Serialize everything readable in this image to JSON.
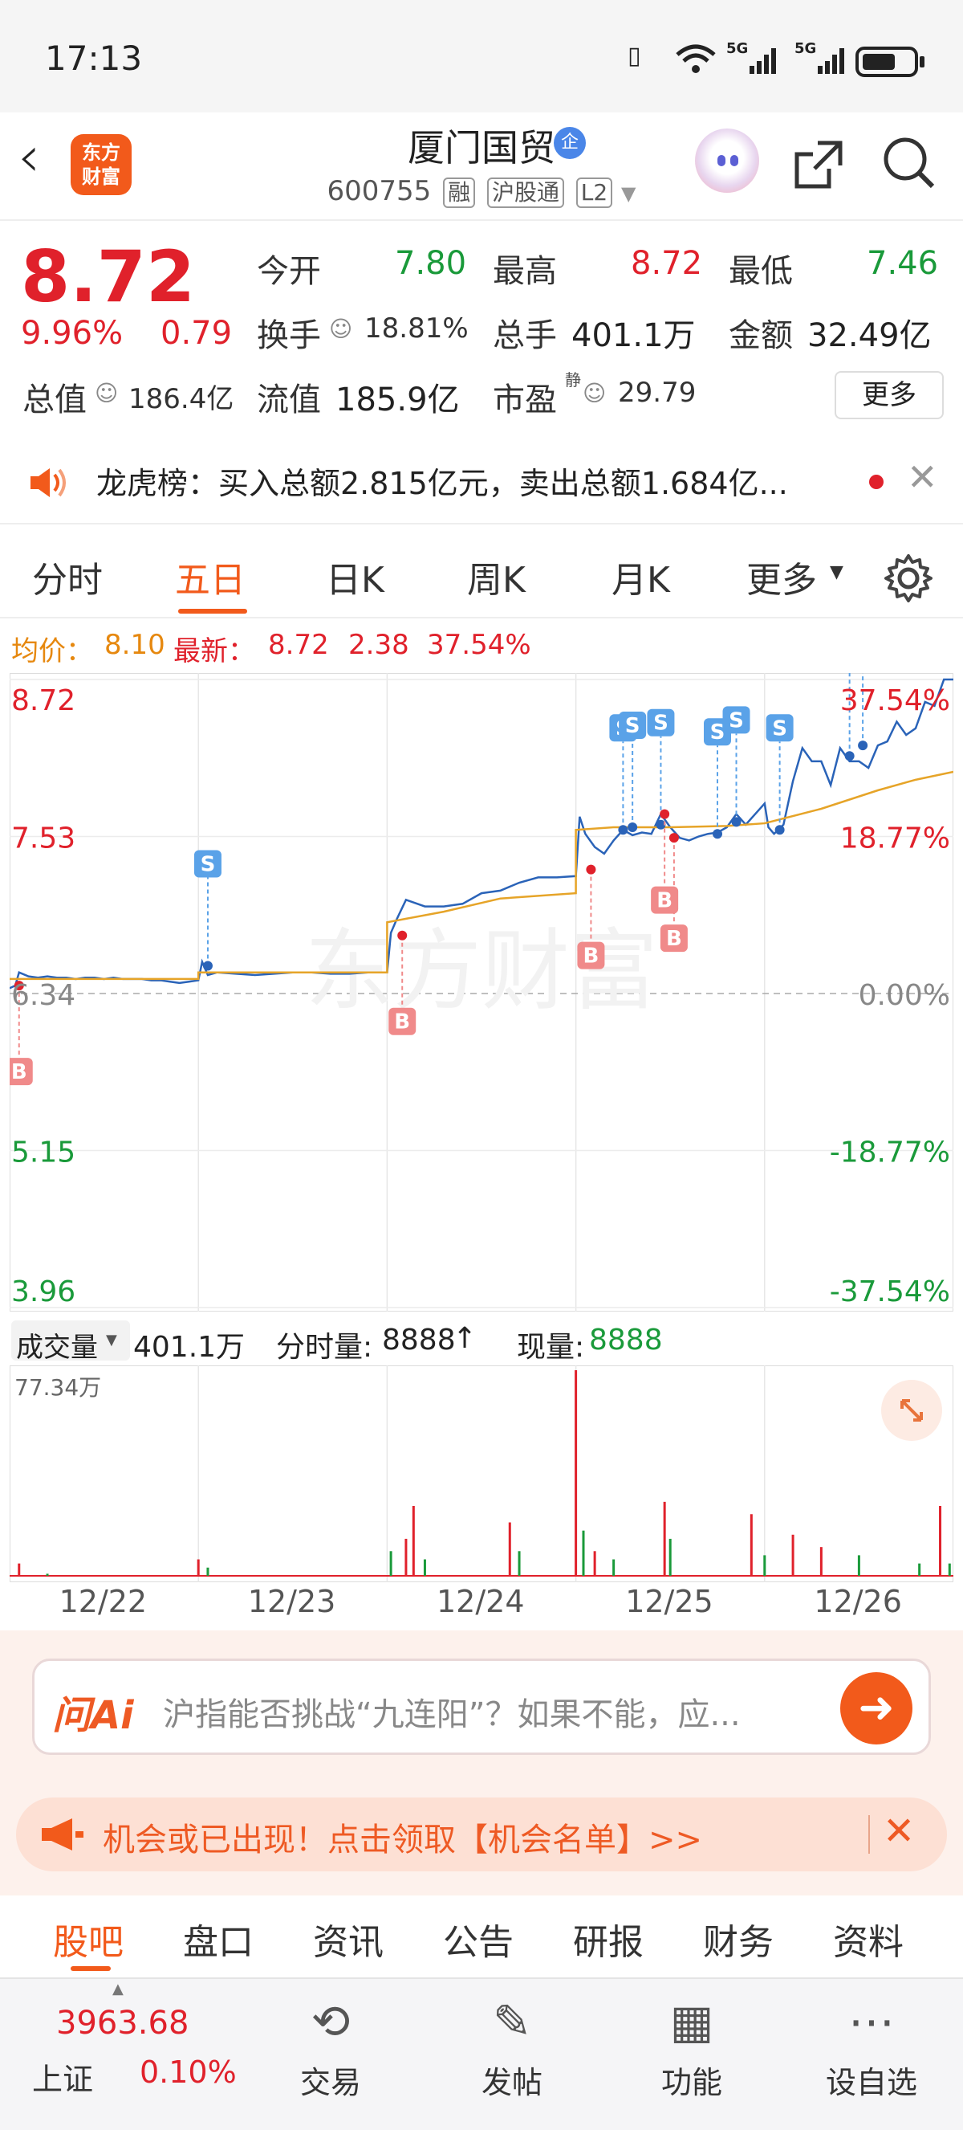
{
  "status_bar": {
    "time": "17:13",
    "icons": [
      "vibrate-icon",
      "wifi-icon",
      "5g-signal-icon",
      "5g-signal-icon",
      "battery-icon"
    ],
    "signal_5g": "5G"
  },
  "header": {
    "logo_line1": "东方",
    "logo_line2": "财富",
    "stock_name": "厦门国贸",
    "badge": "企",
    "code": "600755",
    "tag_rong": "融",
    "tag_hgt": "沪股通",
    "tag_l2": "L2"
  },
  "quote": {
    "price": "8.72",
    "change_pct": "9.96%",
    "change_amt": "0.79",
    "open_label": "今开",
    "open": "7.80",
    "high_label": "最高",
    "high": "8.72",
    "low_label": "最低",
    "low": "7.46",
    "turnover_label": "换手",
    "turnover": "18.81%",
    "volume_label": "总手",
    "volume": "401.1万",
    "amount_label": "金额",
    "amount": "32.49亿",
    "mktcap_label": "总值",
    "mktcap": "186.4亿",
    "float_label": "流值",
    "float": "185.9亿",
    "pe_label": "市盈",
    "pe_sup": "静",
    "pe": "29.79",
    "more": "更多"
  },
  "notice": {
    "text": "龙虎榜：买入总额2.815亿元，卖出总额1.684亿..."
  },
  "tabs": [
    "分时",
    "五日",
    "日K",
    "周K",
    "月K",
    "更多"
  ],
  "active_tab": 1,
  "summary": {
    "avg_label": "均价：",
    "avg": "8.10",
    "latest_label": "最新：",
    "latest": "8.72",
    "change": "2.38",
    "pct": "37.54%"
  },
  "chart_data": {
    "type": "line",
    "title": "",
    "x_categories": [
      "12/22",
      "12/23",
      "12/24",
      "12/25",
      "12/26"
    ],
    "y_left_ticks": [
      "8.72",
      "7.53",
      "6.34",
      "5.15",
      "3.96"
    ],
    "y_right_ticks": [
      "37.54%",
      "18.77%",
      "0.00%",
      "-18.77%",
      "-37.54%"
    ],
    "ylim": [
      3.96,
      8.72
    ],
    "prev_close": 6.34,
    "watermark": "东方财富",
    "series": [
      {
        "name": "price",
        "color": "#2a63b8",
        "x": [
          0,
          0.03,
          0.05,
          0.1,
          0.15,
          0.2,
          0.25,
          0.3,
          0.35,
          0.4,
          0.45,
          0.5,
          0.55,
          0.6,
          0.65,
          0.7,
          0.75,
          0.8,
          0.85,
          0.9,
          0.95,
          1.0,
          1.02,
          1.05,
          1.1,
          1.2,
          1.3,
          1.4,
          1.5,
          1.6,
          1.7,
          1.8,
          1.9,
          2.0,
          2.02,
          2.05,
          2.1,
          2.2,
          2.3,
          2.4,
          2.5,
          2.6,
          2.7,
          2.8,
          2.9,
          3.0,
          3.02,
          3.05,
          3.1,
          3.15,
          3.2,
          3.25,
          3.3,
          3.35,
          3.4,
          3.45,
          3.5,
          3.55,
          3.6,
          3.65,
          3.7,
          3.75,
          3.8,
          3.85,
          3.9,
          3.95,
          4.0,
          4.02,
          4.05,
          4.1,
          4.15,
          4.2,
          4.25,
          4.3,
          4.35,
          4.4,
          4.45,
          4.5,
          4.55,
          4.6,
          4.65,
          4.7,
          4.75,
          4.8,
          4.85,
          4.9,
          4.95,
          5.0
        ],
        "y": [
          6.38,
          6.4,
          6.5,
          6.47,
          6.46,
          6.47,
          6.46,
          6.46,
          6.45,
          6.46,
          6.46,
          6.45,
          6.46,
          6.45,
          6.45,
          6.45,
          6.44,
          6.44,
          6.43,
          6.42,
          6.43,
          6.44,
          6.58,
          6.48,
          6.5,
          6.49,
          6.48,
          6.49,
          6.5,
          6.5,
          6.49,
          6.49,
          6.5,
          6.5,
          6.8,
          6.9,
          7.05,
          7.0,
          7.0,
          7.02,
          7.1,
          7.12,
          7.18,
          7.22,
          7.22,
          7.23,
          7.68,
          7.55,
          7.45,
          7.4,
          7.5,
          7.58,
          7.54,
          7.56,
          7.55,
          7.7,
          7.6,
          7.52,
          7.5,
          7.53,
          7.55,
          7.56,
          7.6,
          7.7,
          7.62,
          7.7,
          7.78,
          7.6,
          7.55,
          7.62,
          7.95,
          8.2,
          8.1,
          8.1,
          7.92,
          8.2,
          8.1,
          8.1,
          8.05,
          8.22,
          8.25,
          8.4,
          8.3,
          8.35,
          8.55,
          8.52,
          8.72,
          8.72
        ]
      },
      {
        "name": "average",
        "color": "#e6a428",
        "x": [
          0,
          0.2,
          0.5,
          0.8,
          1.0,
          1.0,
          1.5,
          2.0,
          2.0,
          2.3,
          2.6,
          3.0,
          3.0,
          3.2,
          3.5,
          3.8,
          4.0,
          4.0,
          4.3,
          4.6,
          4.8,
          5.0
        ],
        "y": [
          6.45,
          6.45,
          6.45,
          6.45,
          6.45,
          6.5,
          6.5,
          6.5,
          6.88,
          6.96,
          7.06,
          7.1,
          7.58,
          7.6,
          7.6,
          7.61,
          7.63,
          7.63,
          7.74,
          7.88,
          7.96,
          8.02
        ]
      }
    ],
    "trade_markers": [
      {
        "label": "B",
        "day": 0.05,
        "price": 6.4
      },
      {
        "label": "S",
        "day": 1.05,
        "price": 6.55
      },
      {
        "label": "B",
        "day": 2.08,
        "price": 6.78
      },
      {
        "label": "B",
        "day": 3.08,
        "price": 7.28
      },
      {
        "label": "S",
        "day": 3.25,
        "price": 7.58
      },
      {
        "label": "S",
        "day": 3.3,
        "price": 7.6
      },
      {
        "label": "S",
        "day": 3.45,
        "price": 7.62
      },
      {
        "label": "B",
        "day": 3.47,
        "price": 7.7
      },
      {
        "label": "B",
        "day": 3.52,
        "price": 7.52
      },
      {
        "label": "S",
        "day": 3.75,
        "price": 7.55
      },
      {
        "label": "S",
        "day": 3.85,
        "price": 7.64
      },
      {
        "label": "S",
        "day": 4.08,
        "price": 7.58
      },
      {
        "label": "S",
        "day": 4.45,
        "price": 8.14
      },
      {
        "label": "S",
        "day": 4.52,
        "price": 8.22
      }
    ]
  },
  "volume": {
    "label": "成交量",
    "total": "401.1万",
    "tick_label": "分时量:",
    "tick": "8888",
    "now_label": "现量:",
    "now": "8888",
    "max": "77.34万",
    "bars": [
      {
        "day": 0.05,
        "h": 0.06,
        "c": "red"
      },
      {
        "day": 0.2,
        "h": 0.01,
        "c": "green"
      },
      {
        "day": 1.0,
        "h": 0.08,
        "c": "red"
      },
      {
        "day": 1.05,
        "h": 0.04,
        "c": "green"
      },
      {
        "day": 2.02,
        "h": 0.12,
        "c": "green"
      },
      {
        "day": 2.1,
        "h": 0.18,
        "c": "red"
      },
      {
        "day": 2.14,
        "h": 0.34,
        "c": "red"
      },
      {
        "day": 2.2,
        "h": 0.08,
        "c": "green"
      },
      {
        "day": 2.65,
        "h": 0.26,
        "c": "red"
      },
      {
        "day": 2.7,
        "h": 0.12,
        "c": "green"
      },
      {
        "day": 3.0,
        "h": 1.0,
        "c": "red"
      },
      {
        "day": 3.04,
        "h": 0.22,
        "c": "green"
      },
      {
        "day": 3.1,
        "h": 0.12,
        "c": "red"
      },
      {
        "day": 3.2,
        "h": 0.08,
        "c": "green"
      },
      {
        "day": 3.47,
        "h": 0.36,
        "c": "red"
      },
      {
        "day": 3.5,
        "h": 0.18,
        "c": "green"
      },
      {
        "day": 3.93,
        "h": 0.3,
        "c": "red"
      },
      {
        "day": 4.0,
        "h": 0.1,
        "c": "green"
      },
      {
        "day": 4.15,
        "h": 0.2,
        "c": "red"
      },
      {
        "day": 4.3,
        "h": 0.14,
        "c": "red"
      },
      {
        "day": 4.5,
        "h": 0.1,
        "c": "green"
      },
      {
        "day": 4.82,
        "h": 0.06,
        "c": "green"
      },
      {
        "day": 4.93,
        "h": 0.34,
        "c": "red"
      },
      {
        "day": 4.98,
        "h": 0.06,
        "c": "green"
      }
    ]
  },
  "ai": {
    "brand": "问Ai",
    "query": "沪指能否挑战“九连阳”？如果不能，应..."
  },
  "promo": {
    "text": "机会或已出现！点击领取【机会名单】>>"
  },
  "bottom_tabs": [
    "股吧",
    "盘口",
    "资讯",
    "公告",
    "研报",
    "财务",
    "资料"
  ],
  "bottom_nav": {
    "index_value": "3963.68",
    "index_name": "上证",
    "index_pct": "0.10%",
    "items": [
      {
        "label": "交易",
        "icon": "yen-cycle-icon"
      },
      {
        "label": "发帖",
        "icon": "edit-icon"
      },
      {
        "label": "功能",
        "icon": "grid-icon"
      },
      {
        "label": "设自选",
        "icon": "more-dots-icon"
      }
    ]
  },
  "colors": {
    "up": "#e0212b",
    "down": "#1a9a3a",
    "brand": "#f25a1b",
    "price_line": "#2a63b8",
    "avg_line": "#e6a428",
    "accent": "#e6880f"
  }
}
